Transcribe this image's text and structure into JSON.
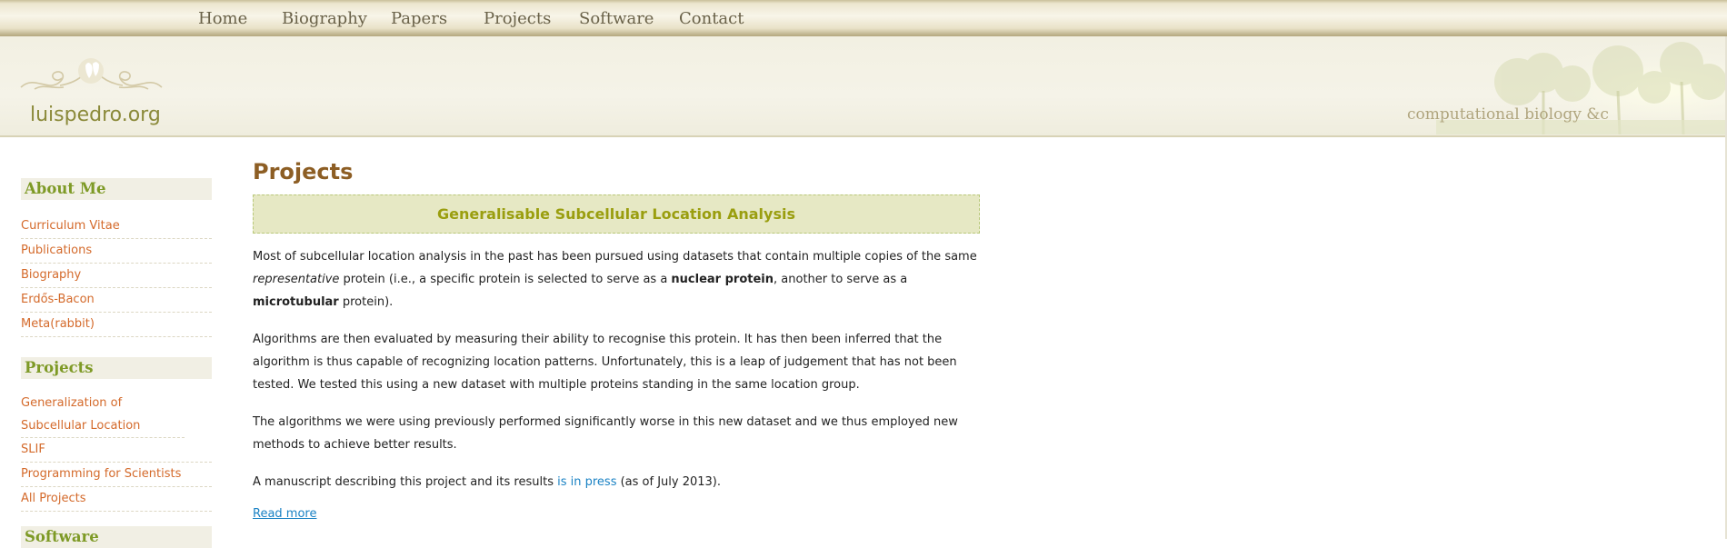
{
  "nav": {
    "items": [
      "Home",
      "Biography",
      "Papers",
      "Projects",
      "Software",
      "Contact"
    ]
  },
  "header": {
    "site_name": "luispedro.org",
    "tagline": "computational biology &c"
  },
  "sidebar": {
    "sections": [
      {
        "heading": "About Me",
        "items": [
          "Curriculum Vitae",
          "Publications",
          "Biography",
          "Erdős-Bacon",
          "Meta(rabbit)"
        ]
      },
      {
        "heading": "Projects",
        "items": [
          "Generalization of Subcellular Location",
          "SLIF",
          "Programming for Scientists",
          "All Projects"
        ]
      },
      {
        "heading": "Software",
        "items": []
      }
    ]
  },
  "main": {
    "title": "Projects",
    "article_title": "Generalisable Subcellular Location Analysis",
    "p1": {
      "a": "Most of subcellular location analysis in the past has been pursued using datasets that contain multiple copies of the same ",
      "em": "representative",
      "b": " protein (i.e., a specific protein is selected to serve as a ",
      "strong1": "nuclear protein",
      "c": ", another to serve as a ",
      "strong2": "microtubular",
      "d": " protein)."
    },
    "p2": "Algorithms are then evaluated by measuring their ability to recognise this protein. It has then been inferred that the algorithm is thus capable of recognizing location patterns. Unfortunately, this is a leap of judgement that has not been tested. We tested this using a new dataset with multiple proteins standing in the same location group.",
    "p3": "The algorithms we were using previously performed significantly worse in this new dataset and we thus employed new methods to achieve better results.",
    "p4": {
      "a": "A manuscript describing this project and its results ",
      "link": "is in press",
      "b": " (as of July 2013)."
    },
    "read_more": "Read more"
  }
}
